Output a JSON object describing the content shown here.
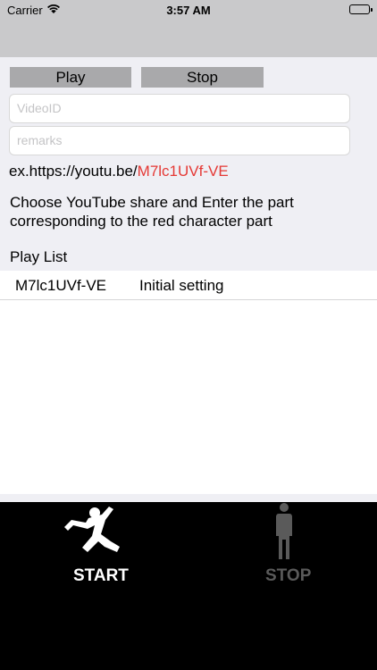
{
  "status_bar": {
    "carrier": "Carrier",
    "time": "3:57 AM"
  },
  "controls": {
    "play_label": "Play",
    "stop_label": "Stop",
    "video_placeholder": "VideoID",
    "remarks_placeholder": "remarks"
  },
  "example": {
    "prefix": "ex.https://youtu.be/",
    "highlight": "M7lc1UVf-VE"
  },
  "instruction": "Choose YouTube share and Enter the part corresponding to the red character part",
  "playlist": {
    "label": "Play List",
    "items": [
      {
        "video_id": "M7lc1UVf-VE",
        "remarks": "Initial setting"
      }
    ]
  },
  "bottom": {
    "start_label": "START",
    "stop_label": "STOP"
  },
  "colors": {
    "highlight": "#e53935",
    "stop_gray": "#5a5a5a"
  }
}
